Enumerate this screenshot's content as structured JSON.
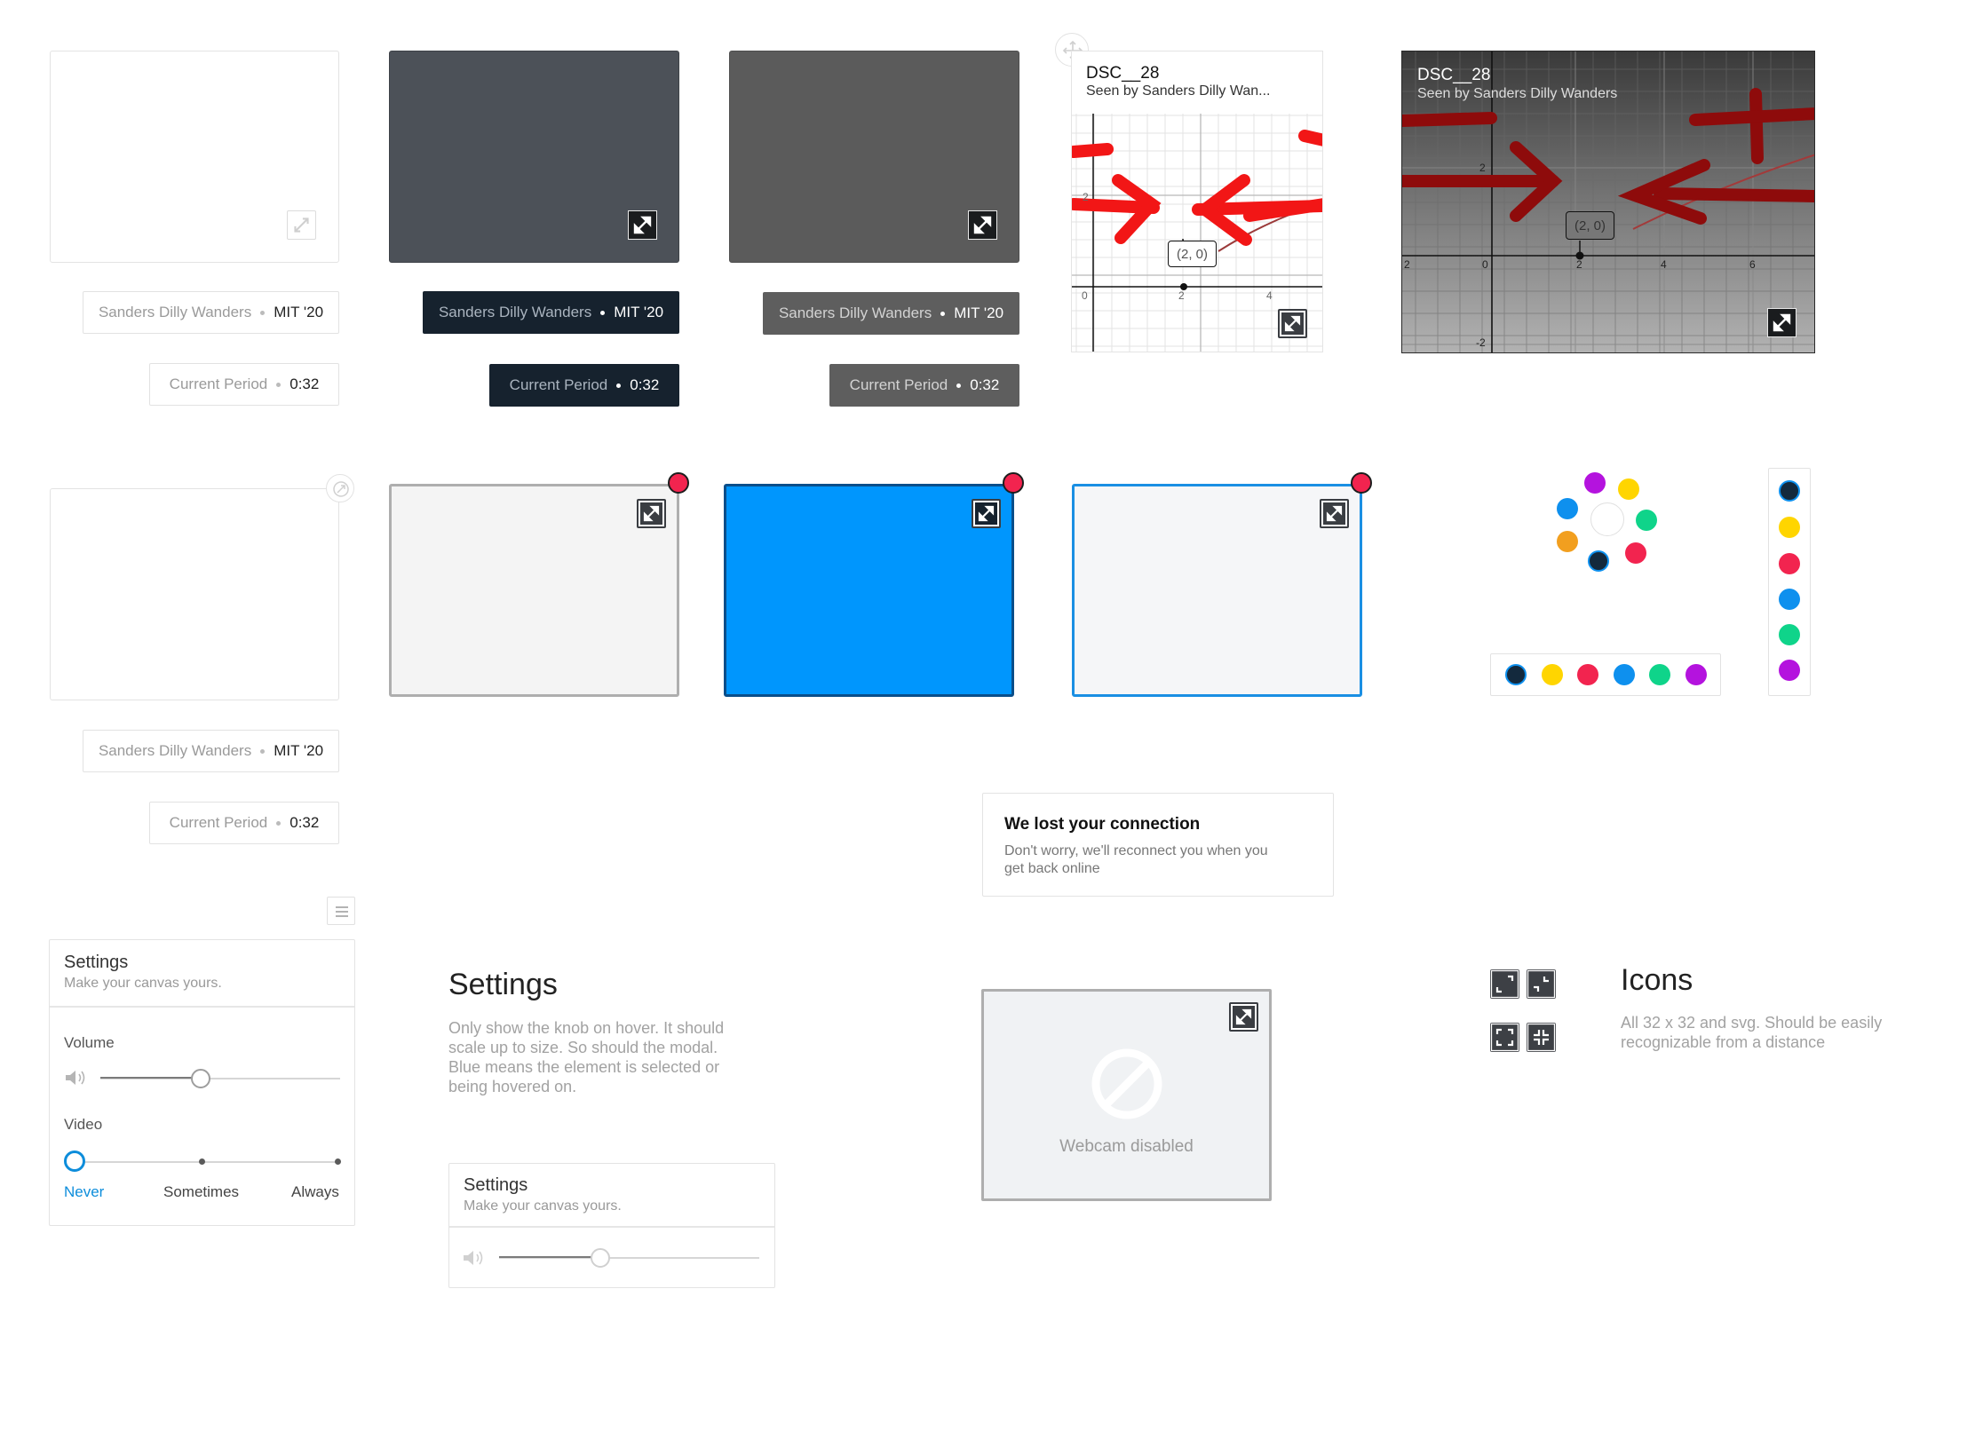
{
  "name_tag": {
    "name": "Sanders Dilly Wanders",
    "school": "MIT '20"
  },
  "period_tag": {
    "label": "Current Period",
    "time": "0:32"
  },
  "graph_cards": {
    "title": "DSC__28",
    "subtitle_truncated": "Seen by Sanders Dilly Wan...",
    "subtitle_full": "Seen by Sanders Dilly Wanders",
    "point_label": "(2, 0)",
    "small_ticks": [
      "0",
      "2",
      "4",
      "2"
    ],
    "dark_ticks": [
      "2",
      "0",
      "2",
      "4",
      "6",
      "2",
      "-2"
    ]
  },
  "connection": {
    "title": "We lost your connection",
    "body": "Don't worry, we'll reconnect you when you get back online"
  },
  "settings_panel": {
    "title": "Settings",
    "subtitle": "Make your canvas yours.",
    "volume_label": "Volume",
    "volume_value": 0.42,
    "video_label": "Video",
    "video_options": [
      "Never",
      "Sometimes",
      "Always"
    ],
    "video_selected": "Never"
  },
  "settings_doc": {
    "title": "Settings",
    "description": "Only show the knob on hover. It should scale up to size. So should the modal. Blue means the element is selected or being hovered on."
  },
  "settings_small": {
    "title": "Settings",
    "subtitle": "Make your canvas yours.",
    "volume_value": 0.39
  },
  "webcam": {
    "message": "Webcam disabled"
  },
  "icons_doc": {
    "title": "Icons",
    "description": "All 32 x 32 and svg. Should be easily recognizable from a distance"
  },
  "colors": {
    "accent_blue": "#0096fd",
    "selection_blue": "#1a8fe3",
    "notification_red": "#f2244f",
    "navy": "#16222e",
    "palette": [
      "#13293d",
      "#ffd500",
      "#f2244f",
      "#0e90ee",
      "#0fd48a",
      "#b413de"
    ],
    "radial_palette": [
      "#b413de",
      "#ffd500",
      "#0fd48a",
      "#f2244f",
      "#13293d",
      "#f29f1f",
      "#0e90ee"
    ]
  },
  "icons": [
    "expand-icon",
    "collapse-icon",
    "fullscreen-icon",
    "exit-fullscreen-icon",
    "move-icon",
    "menu-icon",
    "volume-icon",
    "blocked-icon"
  ]
}
